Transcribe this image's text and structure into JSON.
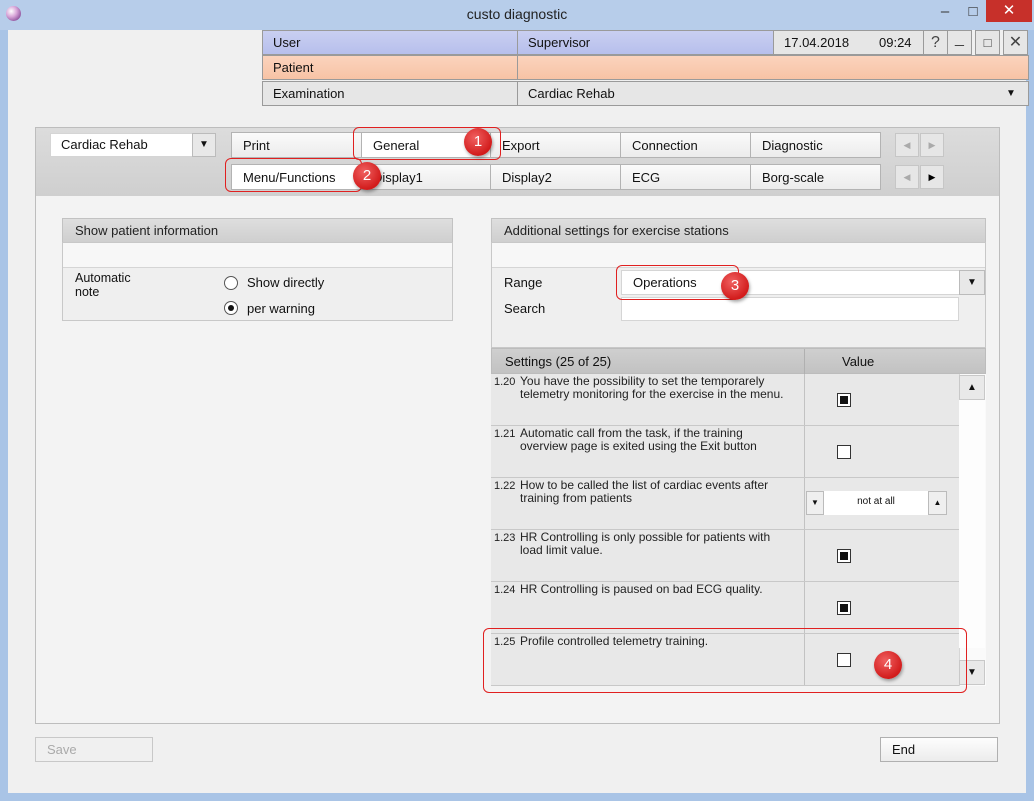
{
  "window": {
    "title": "custo diagnostic",
    "minimize": "–",
    "restore": "□",
    "close": "✕"
  },
  "header": {
    "user_label": "User",
    "user_value": "Supervisor",
    "date": "17.04.2018",
    "time": "09:24",
    "help": "?",
    "minimize": "_",
    "restore": "□",
    "close": "✕",
    "patient_label": "Patient",
    "patient_value": "",
    "exam_label": "Examination",
    "exam_value": "Cardiac Rehab"
  },
  "module_select": {
    "value": "Cardiac Rehab"
  },
  "tabs_row1": [
    "Print",
    "General",
    "Export",
    "Connection",
    "Diagnostic"
  ],
  "tabs_row2": [
    "Menu/Functions",
    "Display1",
    "Display2",
    "ECG",
    "Borg-scale"
  ],
  "nav": {
    "left": "◀",
    "right": "▶"
  },
  "patient_info": {
    "title": "Show patient information",
    "auto_note_label": "Automatic\nnote",
    "options": [
      "Show directly",
      "per warning"
    ],
    "selected_index": 1
  },
  "additional": {
    "title": "Additional settings for exercise stations",
    "range_label": "Range",
    "range_value": "Operations",
    "search_label": "Search",
    "search_value": ""
  },
  "settings_table": {
    "col_settings": "Settings (25 of 25)",
    "col_value": "Value",
    "rows": [
      {
        "num": "1.20",
        "text": "You have the possibility to set the temporarely telemetry monitoring for the exercise in the menu.",
        "type": "checkbox",
        "checked": true
      },
      {
        "num": "1.21",
        "text": "Automatic call from the task, if the training overview page is exited using the Exit button",
        "type": "checkbox",
        "checked": false
      },
      {
        "num": "1.22",
        "text": "How to be called the list of cardiac events after training from patients",
        "type": "spinner",
        "value": "not at all"
      },
      {
        "num": "1.23",
        "text": "HR Controlling is only possible for patients with load limit value.",
        "type": "checkbox",
        "checked": true
      },
      {
        "num": "1.24",
        "text": "HR Controlling is paused on bad ECG quality.",
        "type": "checkbox",
        "checked": true
      },
      {
        "num": "1.25",
        "text": "Profile controlled telemetry training.",
        "type": "checkbox",
        "checked": false
      }
    ]
  },
  "callouts": [
    "1",
    "2",
    "3",
    "4"
  ],
  "footer": {
    "save": "Save",
    "end": "End"
  },
  "colors": {
    "titlebar": "#b7cdea",
    "close": "#c7302a",
    "user_row": "#c0c7ee",
    "patient_row": "#f9c9ae",
    "callout": "#e02020"
  }
}
